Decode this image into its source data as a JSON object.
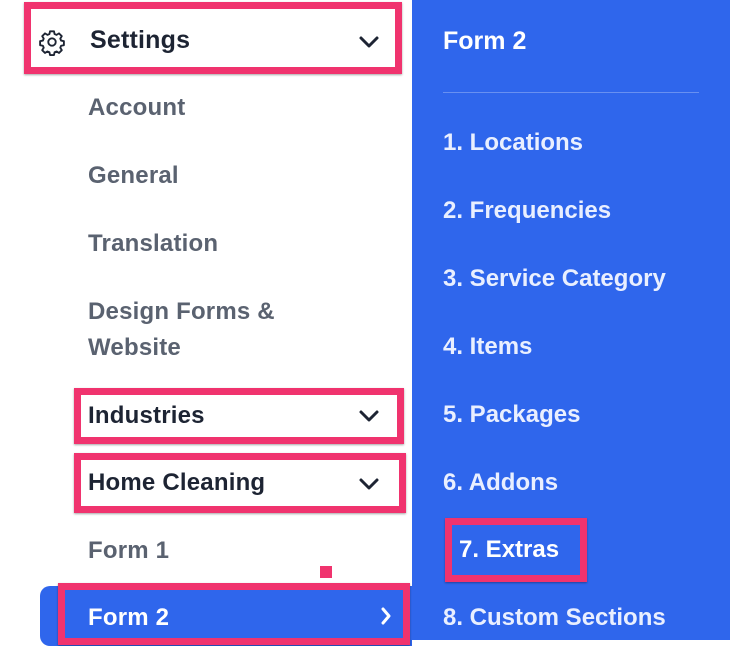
{
  "settings": {
    "label": "Settings",
    "icon": "gear-icon",
    "items": [
      {
        "label": "Account"
      },
      {
        "label": "General"
      },
      {
        "label": "Translation"
      },
      {
        "label": "Design Forms &"
      },
      {
        "label": "Website"
      }
    ]
  },
  "industries": {
    "label": "Industries"
  },
  "home_cleaning": {
    "label": "Home Cleaning",
    "forms": [
      {
        "label": "Form 1"
      },
      {
        "label": "Form 2"
      }
    ]
  },
  "panel": {
    "title": "Form 2",
    "items": [
      {
        "label": "1. Locations"
      },
      {
        "label": "2. Frequencies"
      },
      {
        "label": "3. Service Category"
      },
      {
        "label": "4. Items"
      },
      {
        "label": "5. Packages"
      },
      {
        "label": "6. Addons"
      },
      {
        "label": "7. Extras"
      },
      {
        "label": "8. Custom Sections"
      }
    ]
  },
  "colors": {
    "highlight": "#f0336e",
    "accent": "#2f66ec",
    "text_muted": "#5a6270",
    "text_dark": "#1d2433"
  }
}
